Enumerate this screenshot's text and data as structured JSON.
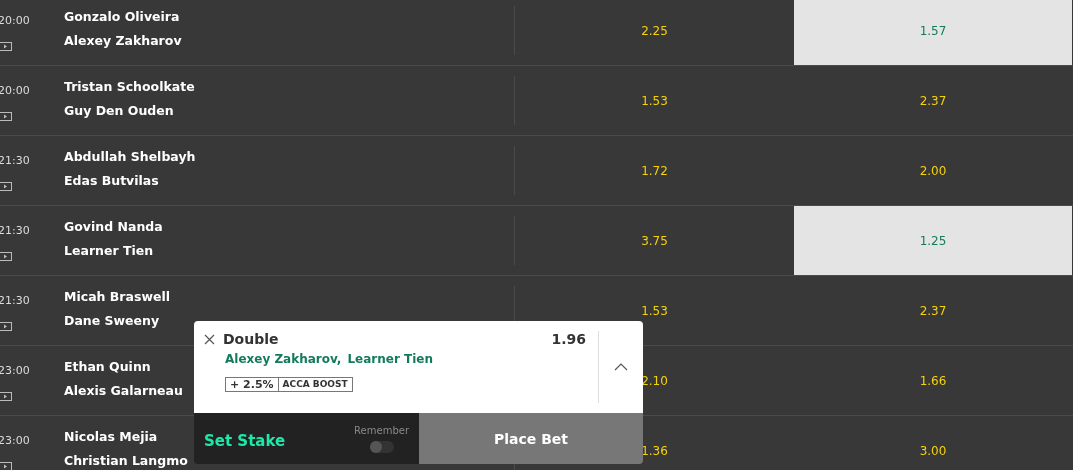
{
  "events": [
    {
      "time": "20:00",
      "players": [
        "Gonzalo Oliveira",
        "Alexey Zakharov"
      ],
      "odds": [
        {
          "value": "2.25",
          "selected": false
        },
        {
          "value": "1.57",
          "selected": true
        }
      ]
    },
    {
      "time": "20:00",
      "players": [
        "Tristan Schoolkate",
        "Guy Den Ouden"
      ],
      "odds": [
        {
          "value": "1.53",
          "selected": false
        },
        {
          "value": "2.37",
          "selected": false
        }
      ]
    },
    {
      "time": "21:30",
      "players": [
        "Abdullah Shelbayh",
        "Edas Butvilas"
      ],
      "odds": [
        {
          "value": "1.72",
          "selected": false
        },
        {
          "value": "2.00",
          "selected": false
        }
      ]
    },
    {
      "time": "21:30",
      "players": [
        "Govind Nanda",
        "Learner Tien"
      ],
      "odds": [
        {
          "value": "3.75",
          "selected": false
        },
        {
          "value": "1.25",
          "selected": true
        }
      ]
    },
    {
      "time": "21:30",
      "players": [
        "Micah Braswell",
        "Dane Sweeny"
      ],
      "odds": [
        {
          "value": "1.53",
          "selected": false
        },
        {
          "value": "2.37",
          "selected": false
        }
      ]
    },
    {
      "time": "23:00",
      "players": [
        "Ethan Quinn",
        "Alexis Galarneau"
      ],
      "odds": [
        {
          "value": "2.10",
          "selected": false
        },
        {
          "value": "1.66",
          "selected": false
        }
      ]
    },
    {
      "time": "23:00",
      "players": [
        "Nicolas Mejia",
        "Christian Langmo"
      ],
      "odds": [
        {
          "value": "1.36",
          "selected": false
        },
        {
          "value": "3.00",
          "selected": false
        }
      ]
    }
  ],
  "bet_slip": {
    "title": "Double",
    "odds": "1.96",
    "selections": [
      "Alexey Zakharov,",
      "Learner Tien"
    ],
    "boost": {
      "percent": "+ 2.5%",
      "label": "ACCA BOOST"
    },
    "set_stake": "Set Stake",
    "remember": {
      "label": "Remember",
      "on": false
    },
    "place_bet": "Place Bet",
    "expanded": false
  }
}
